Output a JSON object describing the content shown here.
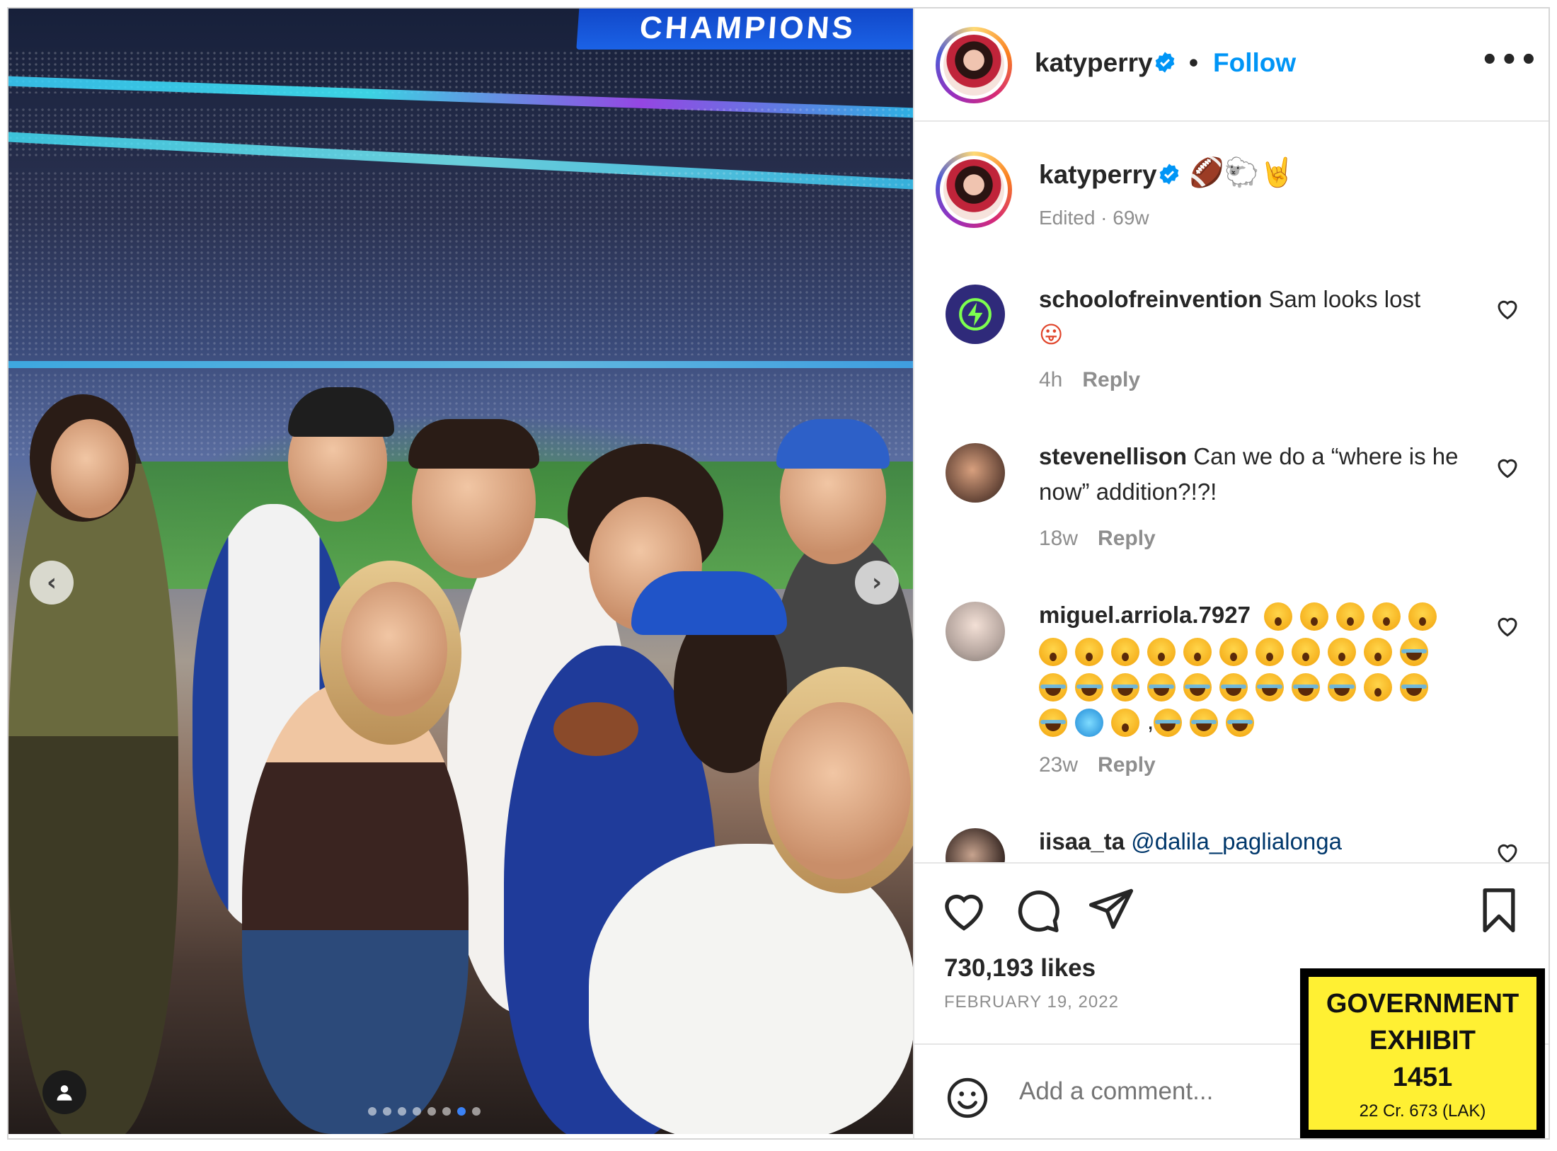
{
  "photo": {
    "jumbotron_text": "CHAMPIONS",
    "carousel_total": 8,
    "carousel_active": 7,
    "colors": {
      "active_dot": "#3b82f6"
    }
  },
  "header": {
    "username": "katyperry",
    "separator": "•",
    "follow_label": "Follow",
    "more_label": "•••"
  },
  "caption": {
    "username": "katyperry",
    "emojis": "🏈🐑🤘",
    "meta": "Edited · 69w"
  },
  "comments": [
    {
      "username": "schoolofreinvention",
      "text": "Sam looks lost",
      "emoji": "😛",
      "time": "4h",
      "reply": "Reply"
    },
    {
      "username": "stevenellison",
      "text": "Can we do a “where is he now” addition?!?!",
      "time": "18w",
      "reply": "Reply"
    },
    {
      "username": "miguel.arriola.7927",
      "text": ",",
      "time": "23w",
      "reply": "Reply"
    },
    {
      "username": "iisaa_ta",
      "mention": "@dalila_paglialonga"
    }
  ],
  "stats": {
    "likes": "730,193 likes",
    "date": "FEBRUARY 19, 2022"
  },
  "compose": {
    "placeholder": "Add a comment..."
  },
  "exhibit": {
    "line1": "GOVERNMENT",
    "line2": "EXHIBIT",
    "line3": "1451",
    "sub": "22 Cr. 673 (LAK)",
    "color": "#fff033"
  },
  "icons": [
    "chevron-left-icon",
    "chevron-right-icon",
    "user-tag-icon",
    "verified-icon",
    "heart-icon",
    "comment-icon",
    "share-icon",
    "bookmark-icon",
    "smiley-icon"
  ],
  "colors": {
    "follow": "#0095f6",
    "verified": "#0095f6",
    "muted": "#8e8e8e"
  }
}
